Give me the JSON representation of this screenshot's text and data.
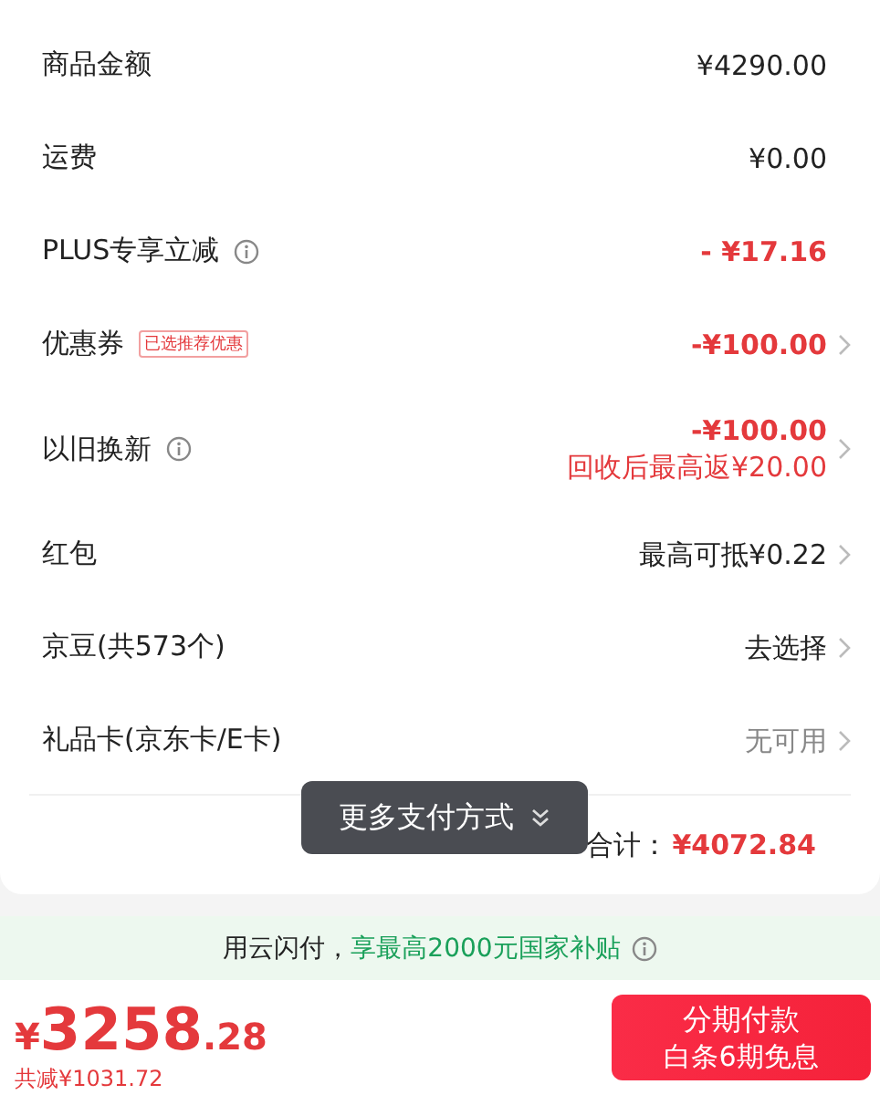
{
  "rows": [
    {
      "label": "商品金额",
      "info": false,
      "values": [
        "¥4290.00"
      ],
      "color": "#222222",
      "chevron": false
    },
    {
      "label": "运费",
      "info": false,
      "values": [
        "¥0.00"
      ],
      "color": "#222222",
      "chevron": false
    },
    {
      "label": "PLUS专享立减",
      "info": true,
      "values": [
        "- ¥17.16"
      ],
      "color": "#e4393c",
      "chevron": false
    },
    {
      "label": "优惠券",
      "info": false,
      "tag": "已选推荐优惠",
      "values": [
        "-¥100.00"
      ],
      "color": "#e4393c",
      "chevron": true
    },
    {
      "label": "以旧换新",
      "info": true,
      "values": [
        "-¥100.00",
        "回收后最高返¥20.00"
      ],
      "color": "#e4393c",
      "chevron": true
    },
    {
      "label": "红包",
      "info": false,
      "values": [
        "最高可抵¥0.22"
      ],
      "color": "#222222",
      "chevron": true
    },
    {
      "label": "京豆(共573个)",
      "info": false,
      "values": [
        "去选择"
      ],
      "color": "#222222",
      "chevron": true
    },
    {
      "label": "礼品卡(京东卡/E卡)",
      "info": false,
      "values": [
        "无可用"
      ],
      "color": "#888888",
      "chevron": true
    }
  ],
  "more_payment": {
    "label": "更多支付方式"
  },
  "total": {
    "label": "合计：",
    "amount": "¥4072.84"
  },
  "banner": {
    "text": "用云闪付，",
    "highlight": "享最高2000元国家补贴"
  },
  "footer": {
    "currency": "¥",
    "integer": "3258",
    "decimal": ".28",
    "saved": "共减¥1031.72",
    "button_title": "分期付款",
    "button_subtitle": "白条6期免息"
  }
}
